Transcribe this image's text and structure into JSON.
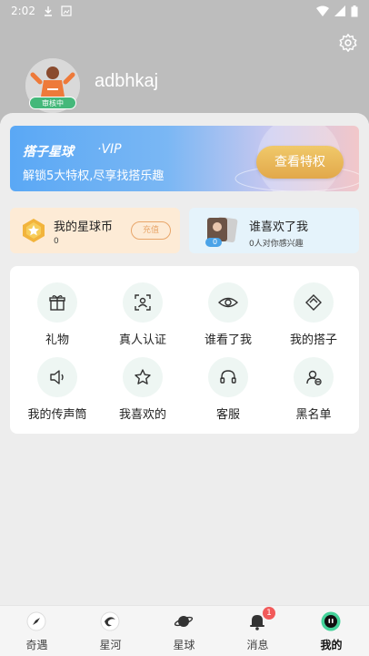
{
  "status_bar": {
    "time": "2:02"
  },
  "profile": {
    "username": "adbhkaj",
    "review_badge": "审核中"
  },
  "vip": {
    "brand": "搭子星球",
    "tag": "·VIP",
    "description": "解锁5大特权,尽享找搭乐趣",
    "button_label": "查看特权"
  },
  "coins": {
    "title": "我的星球币",
    "value": "0",
    "recharge_label": "充值"
  },
  "likes": {
    "title": "谁喜欢了我",
    "count_badge": "0",
    "subtitle": "0人对你感兴趣"
  },
  "features": [
    {
      "label": "礼物",
      "icon": "gift-icon"
    },
    {
      "label": "真人认证",
      "icon": "face-verify-icon"
    },
    {
      "label": "谁看了我",
      "icon": "eye-icon"
    },
    {
      "label": "我的搭子",
      "icon": "partner-icon"
    },
    {
      "label": "我的传声筒",
      "icon": "speaker-icon"
    },
    {
      "label": "我喜欢的",
      "icon": "star-icon"
    },
    {
      "label": "客服",
      "icon": "headset-icon"
    },
    {
      "label": "黑名单",
      "icon": "blacklist-icon"
    }
  ],
  "nav": [
    {
      "label": "奇遇",
      "icon": "compass-icon"
    },
    {
      "label": "星河",
      "icon": "galaxy-icon"
    },
    {
      "label": "星球",
      "icon": "planet-icon"
    },
    {
      "label": "消息",
      "icon": "bell-icon",
      "badge": "1"
    },
    {
      "label": "我的",
      "icon": "profile-icon",
      "active": true
    }
  ],
  "colors": {
    "accent": "#44b87a",
    "vip_button": "#e8b45a",
    "coin_card_bg": "#fdebd6",
    "likes_card_bg": "#e5f3fb"
  }
}
